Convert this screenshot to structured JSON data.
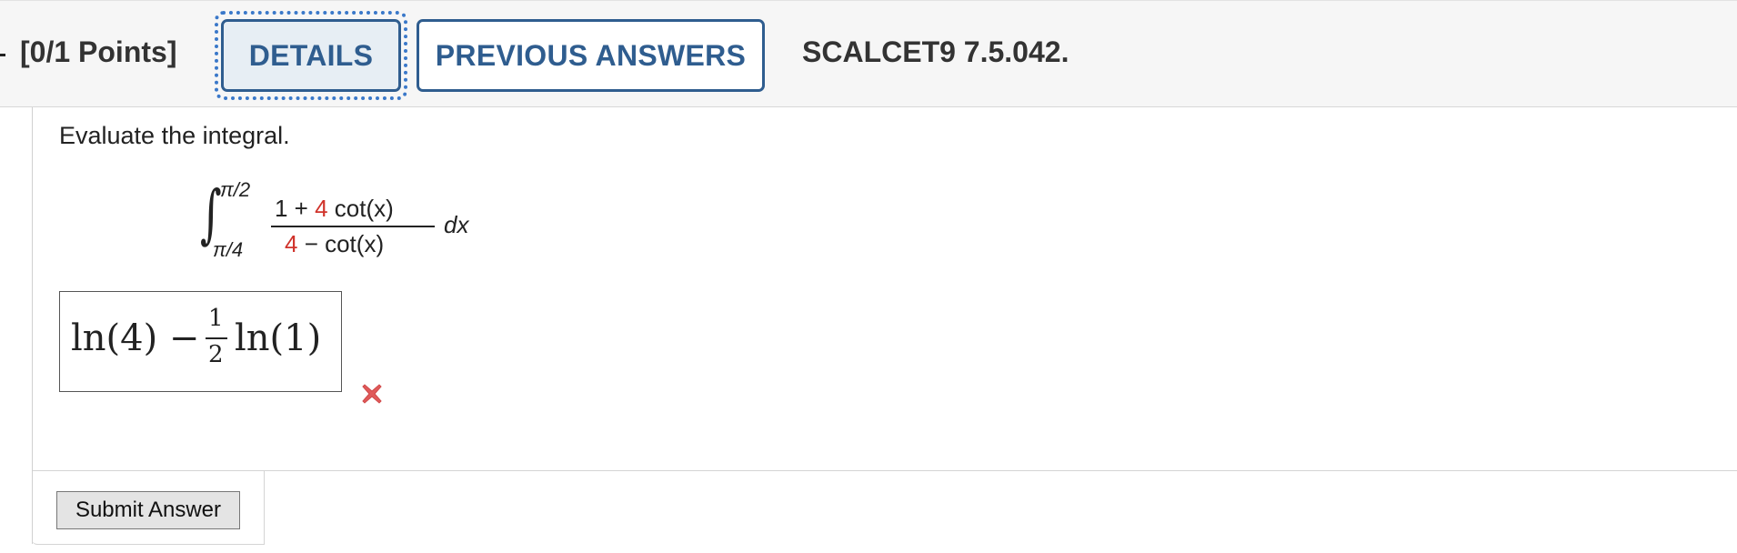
{
  "header": {
    "points": "[0/1 Points]",
    "details_label": "DETAILS",
    "previous_answers_label": "PREVIOUS ANSWERS",
    "question_id": "SCALCET9 7.5.042."
  },
  "question": {
    "prompt": "Evaluate the integral.",
    "upper_limit": "π/2",
    "lower_limit": "π/4",
    "numerator_a": "1 + ",
    "numerator_coef": "4",
    "numerator_b": " cot(x)",
    "denominator_coef": "4",
    "denominator_b": " − cot(x)",
    "differential": "dx"
  },
  "answer": {
    "before_fraction": "ln(4) −",
    "fraction_numerator": "1",
    "fraction_denominator": "2",
    "after_fraction": "ln(1)",
    "status": "incorrect",
    "status_icon": "x-mark-icon",
    "status_color": "#e05a5a"
  },
  "footer": {
    "submit_label": "Submit Answer"
  },
  "colors": {
    "accent": "#2f5d8f",
    "randomized_value": "#d0332b"
  }
}
